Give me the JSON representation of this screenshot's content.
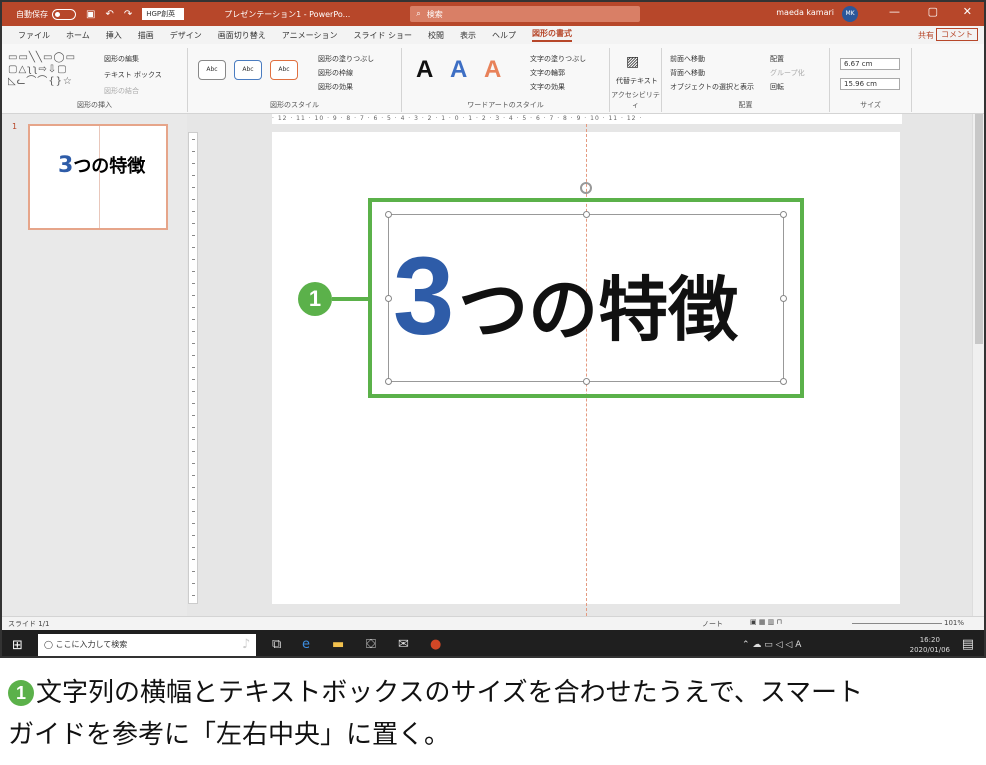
{
  "titlebar": {
    "autosave": "自動保存",
    "font_box": "HGP創英",
    "title": "プレゼンテーション1 - PowerPo...",
    "search": "検索",
    "user": "maeda kamari",
    "avatar": "MK",
    "minimize": "—",
    "restore": "▢",
    "close": "✕"
  },
  "tabs": [
    {
      "label": "ファイル"
    },
    {
      "label": "ホーム"
    },
    {
      "label": "挿入"
    },
    {
      "label": "描画"
    },
    {
      "label": "デザイン"
    },
    {
      "label": "画面切り替え"
    },
    {
      "label": "アニメーション"
    },
    {
      "label": "スライド ショー"
    },
    {
      "label": "校閲"
    },
    {
      "label": "表示"
    },
    {
      "label": "ヘルプ"
    },
    {
      "label": "図形の書式",
      "active": true
    }
  ],
  "tab_right": {
    "share": "共有",
    "comment": "コメント"
  },
  "ribbon": {
    "insert_shapes": {
      "label": "図形の挿入",
      "edit_shape": "図形の編集",
      "text_box": "テキスト ボックス",
      "merge": "図形の結合"
    },
    "shape_styles": {
      "label": "図形のスタイル",
      "abc": "Abc",
      "fill": "図形の塗りつぶし",
      "outline": "図形の枠線",
      "effects": "図形の効果"
    },
    "wordart": {
      "label": "ワードアートのスタイル",
      "sample": "A",
      "text_fill": "文字の塗りつぶし",
      "text_outline": "文字の輪郭",
      "text_effects": "文字の効果"
    },
    "accessibility": {
      "label": "アクセシビリティ",
      "alt_text": "代替テキスト"
    },
    "arrange": {
      "label": "配置",
      "bring_forward": "前面へ移動",
      "send_backward": "背面へ移動",
      "selection_pane": "オブジェクトの選択と表示",
      "align": "配置",
      "group": "グループ化",
      "rotate": "回転"
    },
    "size": {
      "label": "サイズ",
      "height": "6.67 cm",
      "width": "15.96 cm"
    }
  },
  "thumbnail": {
    "number": "1",
    "text_num": "3",
    "text_rest": "つの特徴"
  },
  "ruler_text": "· 12 · 11 · 10 · 9 · 8 · 7 · 6 · 5 · 4 · 3 · 2 · 1 · 0 · 1 · 2 · 3 · 4 · 5 · 6 · 7 · 8 · 9 · 10 · 11 · 12 ·",
  "slide": {
    "text_num": "3",
    "text_rest": "つの特徴"
  },
  "callout": {
    "number": "1"
  },
  "statusbar": {
    "slide": "スライド 1/1",
    "notes": "ノート",
    "zoom": "101%"
  },
  "taskbar": {
    "search": "ここに入力して検索",
    "time": "16:20",
    "date": "2020/01/06"
  },
  "caption": {
    "number": "1",
    "line1": "文字列の横幅とテキストボックスのサイズを合わせたうえで、スマート",
    "line2": "ガイドを参考に「左右中央」に置く。"
  },
  "colors": {
    "accent": "#b7472a",
    "callout_green": "#5bb14a",
    "digit_blue": "#2e5ca8"
  }
}
